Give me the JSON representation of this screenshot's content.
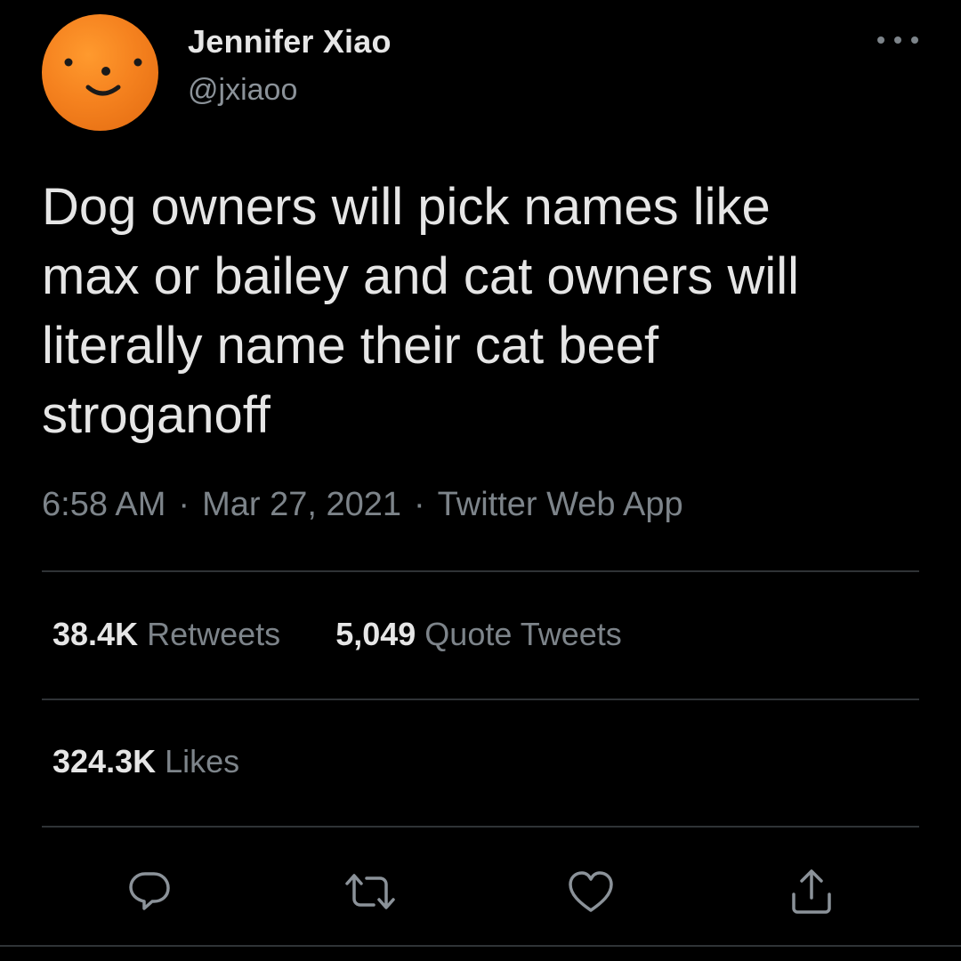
{
  "author": {
    "display_name": "Jennifer Xiao",
    "handle": "@jxiaoo"
  },
  "tweet": {
    "text": "Dog owners will pick names like\nmax or bailey and cat owners will\nliterally name their cat beef\nstroganoff",
    "time": "6:58 AM",
    "date": "Mar 27, 2021",
    "source": "Twitter Web App",
    "separator": "·"
  },
  "stats": {
    "retweets": {
      "count": "38.4K",
      "label": "Retweets"
    },
    "quote_tweets": {
      "count": "5,049",
      "label": "Quote Tweets"
    },
    "likes": {
      "count": "324.3K",
      "label": "Likes"
    }
  },
  "actions": [
    {
      "icon": "reply-icon"
    },
    {
      "icon": "retweet-icon"
    },
    {
      "icon": "like-icon"
    },
    {
      "icon": "share-icon"
    }
  ],
  "colors": {
    "background": "#000000",
    "primary_text": "#e6e6e6",
    "secondary_text": "#7d848a",
    "divider": "#2f3336",
    "avatar_orange": "#f5821f"
  }
}
